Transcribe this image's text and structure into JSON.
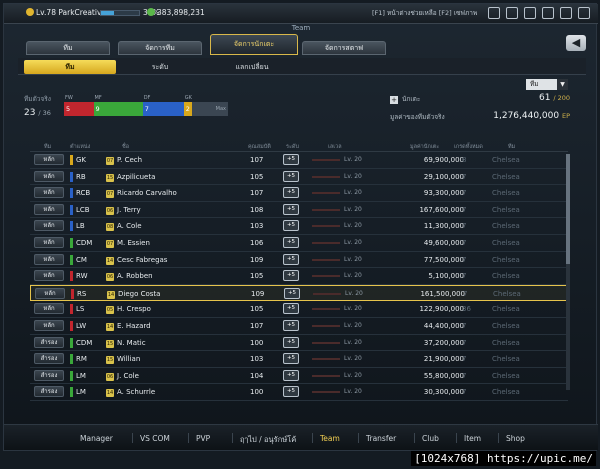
{
  "topbar": {
    "level": "Lv.78 ParkCreative",
    "xp_percent": "33%",
    "xp_fraction": 0.33,
    "coins": "383,898,231",
    "shortcuts": "[F1] หน้าต่างช่วยเหลือ [F2] เซฟภาพ"
  },
  "header": {
    "title": "Team"
  },
  "tabs": [
    "ทีม",
    "จัดการทีม",
    "จัดการนักเตะ",
    "จัดการสตาฟ"
  ],
  "subtabs": [
    "ทีม",
    "ระดับ",
    "แลกเปลี่ยน"
  ],
  "filter": {
    "selected": "ทีม"
  },
  "summary": {
    "squad_label": "ทีมตัวจริง",
    "squad_count": "23",
    "squad_max": "/ 36",
    "positions": [
      {
        "label": "FW",
        "count": "5",
        "color": "#c2262e",
        "share": 0.18
      },
      {
        "label": "MF",
        "count": "9",
        "color": "#3aa73a",
        "share": 0.3
      },
      {
        "label": "DF",
        "count": "7",
        "color": "#2a61c7",
        "share": 0.25
      },
      {
        "label": "GK",
        "count": "2",
        "color": "#d9a81c",
        "share": 0.05
      }
    ],
    "pos_rest": "Max",
    "players_label": "นักเตะ",
    "players_count": "61",
    "players_max": "/ 200",
    "value_label": "มูลค่าของทีมตัวจริง",
    "value": "1,276,440,000",
    "value_unit": "EP"
  },
  "table": {
    "headers": [
      "ทีม",
      "ตำแหน่ง",
      "ชื่อ",
      "คุณสมบัติ",
      "ระดับ",
      "เลเวล",
      "มูลค่านักเตะ",
      "เกรดทั้งหมด",
      "ทีม"
    ],
    "enh_label": "+5",
    "rows": [
      {
        "status": "หลัก",
        "pos": "GK",
        "pcolor": "#d9a81c",
        "season": "07",
        "name": "P. Cech",
        "ovr": "107",
        "lv": "Lv. 20",
        "value": "69,900,000",
        "grade": "8",
        "club": "Chelsea"
      },
      {
        "status": "หลัก",
        "pos": "RB",
        "pcolor": "#2a61c7",
        "season": "15",
        "name": "Azpilicueta",
        "ovr": "105",
        "lv": "Lv. 20",
        "value": "29,100,000",
        "grade": "7",
        "club": "Chelsea"
      },
      {
        "status": "หลัก",
        "pos": "RCB",
        "pcolor": "#2a61c7",
        "season": "07",
        "name": "Ricardo Carvalho",
        "ovr": "107",
        "lv": "Lv. 20",
        "value": "93,300,000",
        "grade": "7",
        "club": "Chelsea"
      },
      {
        "status": "หลัก",
        "pos": "LCB",
        "pcolor": "#2a61c7",
        "season": "06",
        "name": "J. Terry",
        "ovr": "108",
        "lv": "Lv. 20",
        "value": "167,600,000",
        "grade": "7",
        "club": "Chelsea"
      },
      {
        "status": "หลัก",
        "pos": "LB",
        "pcolor": "#2a61c7",
        "season": "08",
        "name": "A. Cole",
        "ovr": "103",
        "lv": "Lv. 20",
        "value": "11,300,000",
        "grade": "7",
        "club": "Chelsea"
      },
      {
        "status": "หลัก",
        "pos": "CDM",
        "pcolor": "#3aa73a",
        "season": "07",
        "name": "M. Essien",
        "ovr": "106",
        "lv": "Lv. 20",
        "value": "49,600,000",
        "grade": "7",
        "club": "Chelsea"
      },
      {
        "status": "หลัก",
        "pos": "CM",
        "pcolor": "#3aa73a",
        "season": "14",
        "name": "Cesc Fabregas",
        "ovr": "109",
        "lv": "Lv. 20",
        "value": "77,500,000",
        "grade": "7",
        "club": "Chelsea"
      },
      {
        "status": "หลัก",
        "pos": "RW",
        "pcolor": "#c2262e",
        "season": "06",
        "name": "A. Robben",
        "ovr": "105",
        "lv": "Lv. 20",
        "value": "5,100,000",
        "grade": "7",
        "club": "Chelsea"
      },
      {
        "status": "หลัก",
        "pos": "RS",
        "pcolor": "#c2262e",
        "season": "14",
        "name": "Diego Costa",
        "ovr": "109",
        "lv": "Lv. 20",
        "value": "161,500,000",
        "grade": "7",
        "club": "Chelsea",
        "selected": true
      },
      {
        "status": "หลัก",
        "pos": "LS",
        "pcolor": "#c2262e",
        "season": "05",
        "name": "H. Crespo",
        "ovr": "105",
        "lv": "Lv. 20",
        "value": "122,900,000",
        "grade": "36",
        "club": "Chelsea"
      },
      {
        "status": "หลัก",
        "pos": "LW",
        "pcolor": "#c2262e",
        "season": "14",
        "name": "E. Hazard",
        "ovr": "107",
        "lv": "Lv. 20",
        "value": "44,400,000",
        "grade": "7",
        "club": "Chelsea"
      },
      {
        "status": "สำรอง",
        "pos": "CDM",
        "pcolor": "#3aa73a",
        "season": "15",
        "name": "N. Matic",
        "ovr": "100",
        "lv": "Lv. 20",
        "value": "37,200,000",
        "grade": "7",
        "club": "Chelsea"
      },
      {
        "status": "สำรอง",
        "pos": "RM",
        "pcolor": "#3aa73a",
        "season": "15",
        "name": "Willian",
        "ovr": "103",
        "lv": "Lv. 20",
        "value": "21,900,000",
        "grade": "7",
        "club": "Chelsea"
      },
      {
        "status": "สำรอง",
        "pos": "LM",
        "pcolor": "#3aa73a",
        "season": "06",
        "name": "J. Cole",
        "ovr": "104",
        "lv": "Lv. 20",
        "value": "55,800,000",
        "grade": "7",
        "club": "Chelsea"
      },
      {
        "status": "สำรอง",
        "pos": "LM",
        "pcolor": "#3aa73a",
        "season": "14",
        "name": "A. Schurrle",
        "ovr": "100",
        "lv": "Lv. 20",
        "value": "30,300,000",
        "grade": "7",
        "club": "Chelsea"
      }
    ]
  },
  "nav": [
    "Manager",
    "VS COM",
    "PVP",
    "ฤๅไป / อนุรักษ์โค้",
    "Team",
    "Transfer",
    "Club",
    "Item",
    "Shop"
  ],
  "nav_active": "Team",
  "watermark": "[1024x768] https://upic.me/"
}
